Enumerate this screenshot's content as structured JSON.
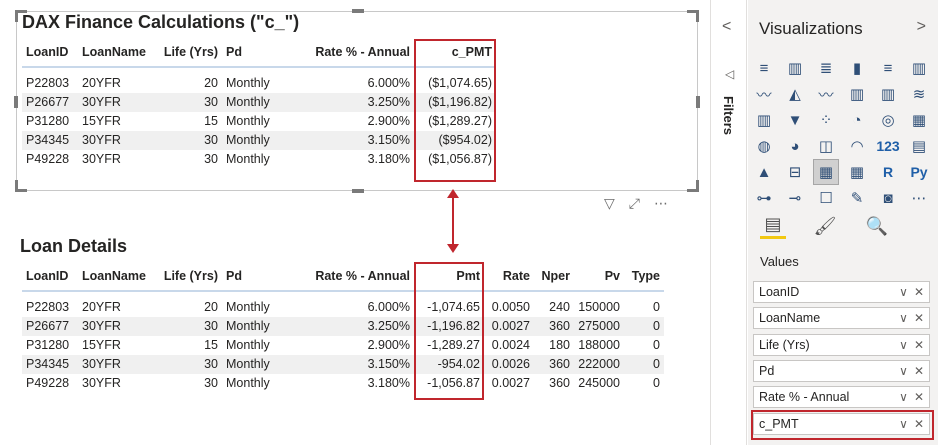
{
  "visual1": {
    "title": "DAX Finance Calculations (\"c_\")",
    "headers": [
      "LoanID",
      "LoanName",
      "Life (Yrs)",
      "Pd",
      "Rate % - Annual",
      "c_PMT"
    ],
    "rows": [
      [
        "P22803",
        "20YFR",
        "20",
        "Monthly",
        "6.000%",
        "($1,074.65)"
      ],
      [
        "P26677",
        "30YFR",
        "30",
        "Monthly",
        "3.250%",
        "($1,196.82)"
      ],
      [
        "P31280",
        "15YFR",
        "15",
        "Monthly",
        "2.900%",
        "($1,289.27)"
      ],
      [
        "P34345",
        "30YFR",
        "30",
        "Monthly",
        "3.150%",
        "($954.02)"
      ],
      [
        "P49228",
        "30YFR",
        "30",
        "Monthly",
        "3.180%",
        "($1,056.87)"
      ]
    ]
  },
  "visual2": {
    "title": "Loan Details",
    "headers": [
      "LoanID",
      "LoanName",
      "Life (Yrs)",
      "Pd",
      "Rate % - Annual",
      "Pmt",
      "Rate",
      "Nper",
      "Pv",
      "Type"
    ],
    "rows": [
      [
        "P22803",
        "20YFR",
        "20",
        "Monthly",
        "6.000%",
        "-1,074.65",
        "0.0050",
        "240",
        "150000",
        "0"
      ],
      [
        "P26677",
        "30YFR",
        "30",
        "Monthly",
        "3.250%",
        "-1,196.82",
        "0.0027",
        "360",
        "275000",
        "0"
      ],
      [
        "P31280",
        "15YFR",
        "15",
        "Monthly",
        "2.900%",
        "-1,289.27",
        "0.0024",
        "180",
        "188000",
        "0"
      ],
      [
        "P34345",
        "30YFR",
        "30",
        "Monthly",
        "3.150%",
        "-954.02",
        "0.0026",
        "360",
        "222000",
        "0"
      ],
      [
        "P49228",
        "30YFR",
        "30",
        "Monthly",
        "3.180%",
        "-1,056.87",
        "0.0027",
        "360",
        "245000",
        "0"
      ]
    ]
  },
  "filters": {
    "label": "Filters",
    "collapse_glyph": "<"
  },
  "visualizations": {
    "title": "Visualizations",
    "expand_glyph": ">",
    "icons": [
      "stacked-bar-icon",
      "stacked-column-icon",
      "clustered-bar-icon",
      "clustered-column-icon",
      "100-stacked-bar-icon",
      "100-stacked-column-icon",
      "line-chart-icon",
      "area-chart-icon",
      "stacked-area-icon",
      "line-column-icon",
      "line-clustered-column-icon",
      "ribbon-chart-icon",
      "waterfall-icon",
      "funnel-icon",
      "scatter-icon",
      "pie-icon",
      "donut-icon",
      "treemap-icon",
      "map-icon",
      "filled-map-icon",
      "shape-map-icon",
      "gauge-icon",
      "card-icon",
      "multi-row-card-icon",
      "kpi-icon",
      "slicer-icon",
      "table-icon",
      "matrix-icon",
      "r-visual-icon",
      "python-visual-icon",
      "key-influencers-icon",
      "decomposition-tree-icon",
      "qa-icon",
      "smart-narrative-icon",
      "paginated-report-icon",
      "more-visuals-icon"
    ],
    "icon_glyphs": [
      "≡",
      "▥",
      "≣",
      "▮",
      "≡",
      "▥",
      "〰",
      "◭",
      "〰",
      "▥",
      "▥",
      "≋",
      "▥",
      "▼",
      "⁘",
      "◔",
      "◎",
      "▦",
      "◍",
      "◕",
      "◫",
      "◠",
      "123",
      "▤",
      "▲",
      "⊟",
      "▦",
      "▦",
      "R",
      "Py",
      "⊶",
      "⊸",
      "☐",
      "✎",
      "◙",
      "⋯"
    ],
    "selected_index": 26,
    "tabs": [
      "fields-tab-icon",
      "format-tab-icon",
      "analytics-tab-icon"
    ],
    "tab_glyphs": [
      "▤",
      "🖌",
      "🔍"
    ],
    "values_label": "Values",
    "wells": [
      "LoanID",
      "LoanName",
      "Life (Yrs)",
      "Pd",
      "Rate % - Annual",
      "c_PMT"
    ],
    "well_chevron": "∨",
    "well_remove": "✕"
  },
  "visual_header": {
    "filter_glyph": "▽",
    "focus_glyph": "⤢",
    "more_glyph": "⋯"
  },
  "colors": {
    "highlight": "#c0262d",
    "header_rule": "#c8d8ea",
    "alt_row": "#f0f0f0",
    "pane_bg": "#f3f2f1"
  }
}
